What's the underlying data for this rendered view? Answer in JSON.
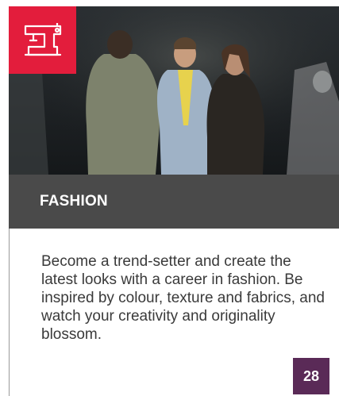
{
  "category": {
    "title": "FASHION",
    "icon": "sewing-machine-icon",
    "color": "#e31d3c"
  },
  "photo": {
    "alt": ""
  },
  "description": "Become a trend-setter and create the latest looks with a career in fashion. Be inspired by colour, texture and fabrics, and watch your creativity and originality blossom.",
  "page_number": "28",
  "colors": {
    "bar": "#4a4a4a",
    "page_badge": "#5a2a57",
    "text": "#3a3a3a"
  }
}
